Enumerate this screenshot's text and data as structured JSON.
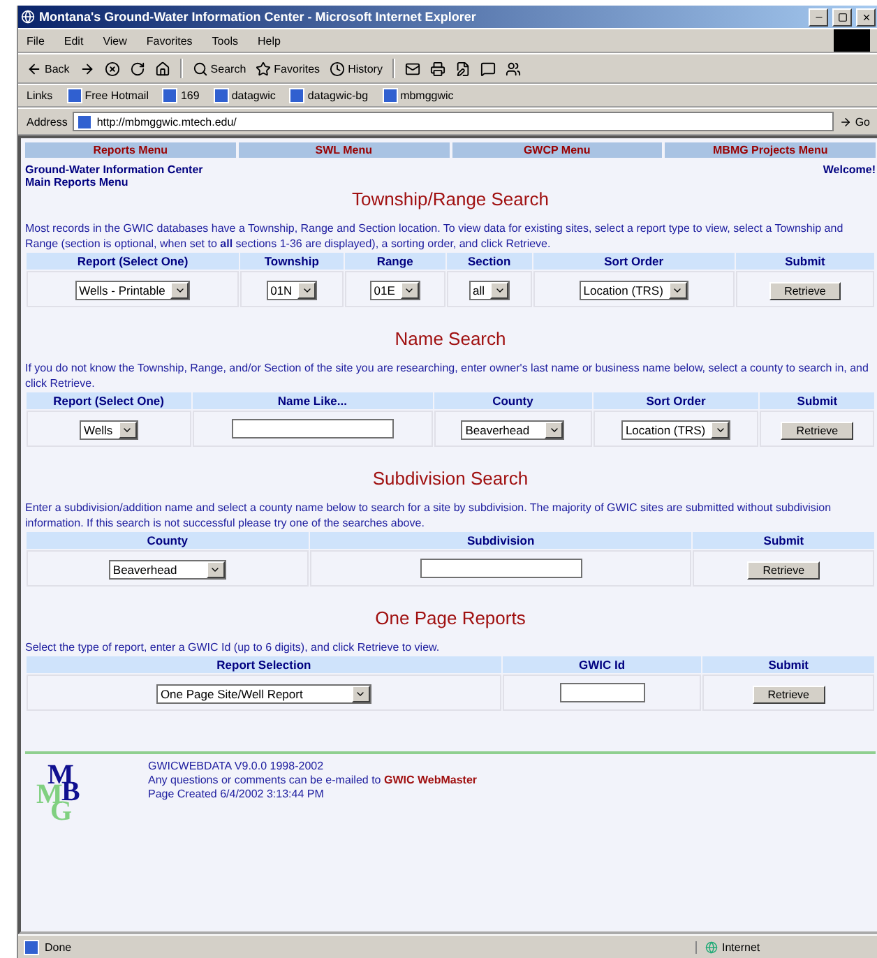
{
  "window": {
    "title": "Montana's Ground-Water Information Center - Microsoft Internet Explorer"
  },
  "menu_bar": [
    "File",
    "Edit",
    "View",
    "Favorites",
    "Tools",
    "Help"
  ],
  "toolbar": [
    {
      "kind": "back",
      "label": "Back"
    },
    {
      "kind": "forward"
    },
    {
      "kind": "stop"
    },
    {
      "kind": "refresh"
    },
    {
      "kind": "home"
    },
    {
      "kind": "search",
      "label": "Search"
    },
    {
      "kind": "favorites",
      "label": "Favorites"
    },
    {
      "kind": "history",
      "label": "History"
    },
    {
      "kind": "mail"
    },
    {
      "kind": "print"
    },
    {
      "kind": "edit"
    },
    {
      "kind": "discuss"
    },
    {
      "kind": "messenger"
    }
  ],
  "links_bar": {
    "label": "Links",
    "items": [
      "Free Hotmail",
      "169",
      "datagwic",
      "datagwic-bg",
      "mbmggwic"
    ]
  },
  "address_bar": {
    "label": "Address",
    "value": "http://mbmggwic.mtech.edu/",
    "go": "Go"
  },
  "nav_menu": [
    "Reports Menu",
    "SWL Menu",
    "GWCP Menu",
    "MBMG Projects Menu"
  ],
  "header": {
    "lines": [
      "Ground-Water Information Center",
      "Main Reports Menu"
    ],
    "welcome": "Welcome!"
  },
  "sections": [
    {
      "title": "Township/Range Search",
      "description": "Most records in the GWIC databases have a Township, Range and Section location. To view data for existing sites, select a report type to view, select a Township and Range (section is optional, when set to **all** sections 1-36 are displayed), a sorting order, and click Retrieve.",
      "columns": [
        "Report (Select One)",
        "Township",
        "Range",
        "Section",
        "Sort Order",
        "Submit"
      ],
      "row": [
        {
          "kind": "select",
          "value": "Wells - Printable"
        },
        {
          "kind": "select",
          "value": "01N"
        },
        {
          "kind": "select",
          "value": "01E"
        },
        {
          "kind": "select",
          "value": "all"
        },
        {
          "kind": "select",
          "value": "Location (TRS)"
        },
        {
          "kind": "button",
          "value": "Retrieve"
        }
      ]
    },
    {
      "title": "Name Search",
      "description": "If you do not know the Township, Range, and/or Section of the site you are researching, enter owner's last name or business name below, select a county to search in, and click Retrieve.",
      "columns": [
        "Report (Select One)",
        "Name Like...",
        "County",
        "Sort Order",
        "Submit"
      ],
      "row": [
        {
          "kind": "select",
          "value": "Wells"
        },
        {
          "kind": "input"
        },
        {
          "kind": "select",
          "value": "Beaverhead"
        },
        {
          "kind": "select",
          "value": "Location (TRS)"
        },
        {
          "kind": "button",
          "value": "Retrieve"
        }
      ]
    },
    {
      "title": "Subdivision Search",
      "description": "Enter a subdivision/addition name and select a county name below to search for a site by subdivision. The majority of GWIC sites are submitted without subdivision information. If this search is not successful please try one of the searches above.",
      "columns": [
        "County",
        "Subdivision",
        "Submit"
      ],
      "row": [
        {
          "kind": "select",
          "value": "Beaverhead"
        },
        {
          "kind": "input"
        },
        {
          "kind": "button",
          "value": "Retrieve"
        }
      ]
    },
    {
      "title": "One Page Reports",
      "description": "Select the type of report, enter a GWIC Id (up to 6 digits), and click Retrieve to view.",
      "columns": [
        "Report Selection",
        "GWIC Id",
        "Submit"
      ],
      "row": [
        {
          "kind": "select",
          "value": "One Page Site/Well Report"
        },
        {
          "kind": "input"
        },
        {
          "kind": "button",
          "value": "Retrieve"
        }
      ]
    }
  ],
  "footer": {
    "logo": [
      "M",
      "B",
      "M",
      "G"
    ],
    "version": "GWICWEBDATA V9.0.0 1998-2002",
    "contact": "Any questions or comments can be e-mailed to",
    "link": "GWIC WebMaster",
    "created": "Page Created 6/4/2002 3:13:44 PM"
  },
  "status_bar": {
    "text": "Done",
    "zone": "Internet"
  }
}
